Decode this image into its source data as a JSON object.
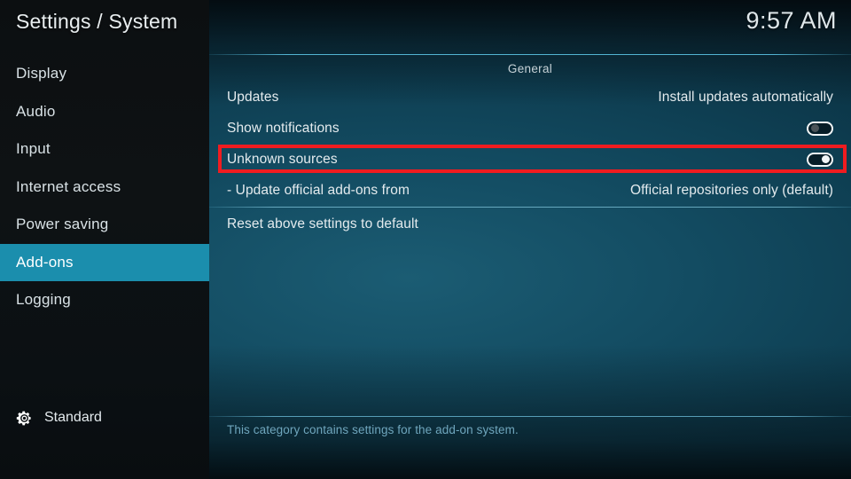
{
  "header": {
    "title": "Settings / System",
    "clock": "9:57 AM"
  },
  "sidebar": {
    "items": [
      {
        "label": "Display",
        "selected": false
      },
      {
        "label": "Audio",
        "selected": false
      },
      {
        "label": "Input",
        "selected": false
      },
      {
        "label": "Internet access",
        "selected": false
      },
      {
        "label": "Power saving",
        "selected": false
      },
      {
        "label": "Add-ons",
        "selected": true
      },
      {
        "label": "Logging",
        "selected": false
      }
    ],
    "level": {
      "icon": "gear-icon",
      "label": "Standard"
    }
  },
  "main": {
    "group_header": "General",
    "rows": [
      {
        "label": "Updates",
        "value": "Install updates automatically",
        "control": "text"
      },
      {
        "label": "Show notifications",
        "value": "",
        "control": "toggle",
        "toggle_state": "off"
      },
      {
        "label": "Unknown sources",
        "value": "",
        "control": "toggle",
        "toggle_state": "on",
        "highlighted": true
      },
      {
        "label": "- Update official add-ons from",
        "value": "Official repositories only (default)",
        "control": "text"
      },
      {
        "label": "Reset above settings to default",
        "value": "",
        "control": "none"
      }
    ],
    "footer_description": "This category contains settings for the add-on system."
  },
  "annotation": {
    "target": "Unknown sources",
    "color": "#f01c20"
  },
  "colors": {
    "accent": "#1b8ead",
    "panel_bg": "#134c62",
    "sidebar_bg": "#0e1214",
    "text": "#e4ebee",
    "muted_text": "#6fa6bd",
    "annotation_red": "#f01c20"
  }
}
